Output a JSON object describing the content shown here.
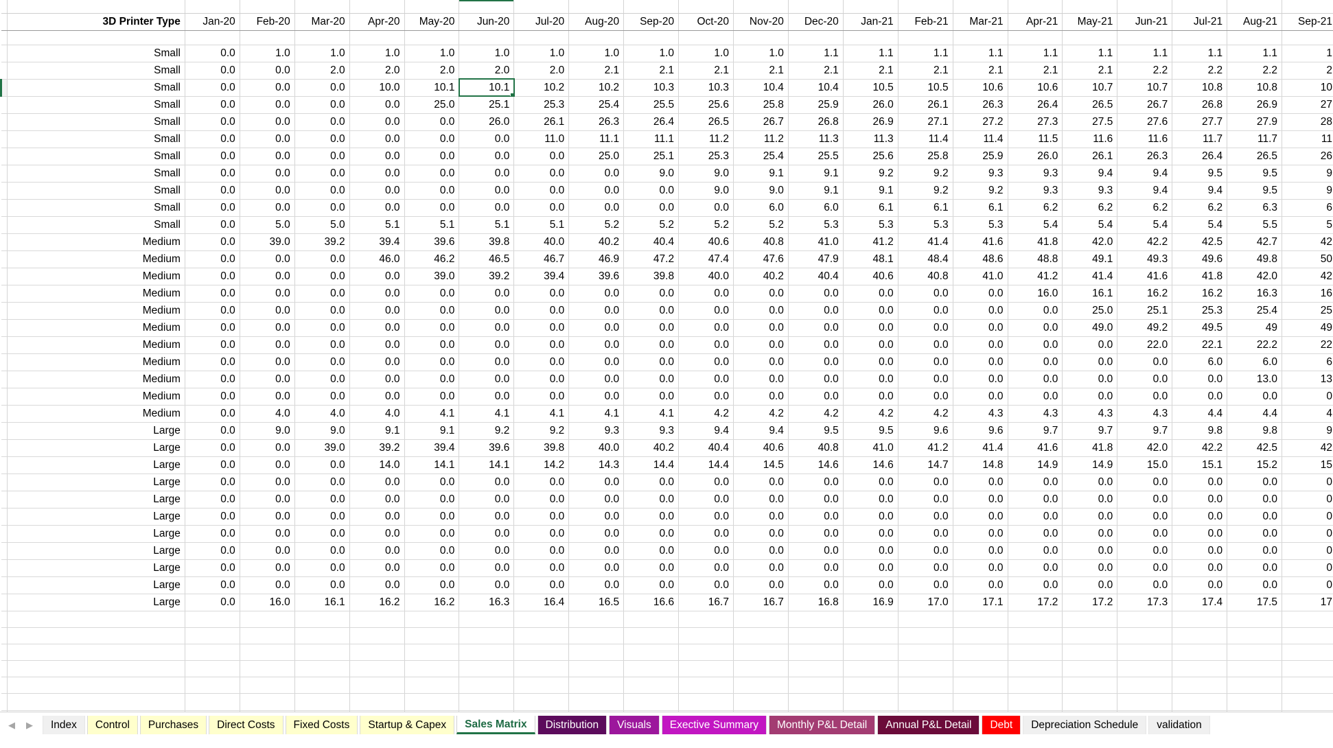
{
  "sheet": {
    "corner_label": "3D Printer Type",
    "months": [
      "Jan-20",
      "Feb-20",
      "Mar-20",
      "Apr-20",
      "May-20",
      "Jun-20",
      "Jul-20",
      "Aug-20",
      "Sep-20",
      "Oct-20",
      "Nov-20",
      "Dec-20",
      "Jan-21",
      "Feb-21",
      "Mar-21",
      "Apr-21",
      "May-21",
      "Jun-21",
      "Jul-21",
      "Aug-21",
      "Sep-21"
    ],
    "selection": {
      "column": "Jun-20",
      "row_index": 2,
      "value": "10.1",
      "border_color": "#217346"
    },
    "rows": [
      {
        "label": "Small",
        "values": [
          "0.0",
          "1.0",
          "1.0",
          "1.0",
          "1.0",
          "1.0",
          "1.0",
          "1.0",
          "1.0",
          "1.0",
          "1.0",
          "1.1",
          "1.1",
          "1.1",
          "1.1",
          "1.1",
          "1.1",
          "1.1",
          "1.1",
          "1.1",
          "1"
        ]
      },
      {
        "label": "Small",
        "values": [
          "0.0",
          "0.0",
          "2.0",
          "2.0",
          "2.0",
          "2.0",
          "2.0",
          "2.1",
          "2.1",
          "2.1",
          "2.1",
          "2.1",
          "2.1",
          "2.1",
          "2.1",
          "2.1",
          "2.1",
          "2.2",
          "2.2",
          "2.2",
          "2"
        ]
      },
      {
        "label": "Small",
        "values": [
          "0.0",
          "0.0",
          "0.0",
          "10.0",
          "10.1",
          "10.1",
          "10.2",
          "10.2",
          "10.3",
          "10.3",
          "10.4",
          "10.4",
          "10.5",
          "10.5",
          "10.6",
          "10.6",
          "10.7",
          "10.7",
          "10.8",
          "10.8",
          "10"
        ]
      },
      {
        "label": "Small",
        "values": [
          "0.0",
          "0.0",
          "0.0",
          "0.0",
          "25.0",
          "25.1",
          "25.3",
          "25.4",
          "25.5",
          "25.6",
          "25.8",
          "25.9",
          "26.0",
          "26.1",
          "26.3",
          "26.4",
          "26.5",
          "26.7",
          "26.8",
          "26.9",
          "27"
        ]
      },
      {
        "label": "Small",
        "values": [
          "0.0",
          "0.0",
          "0.0",
          "0.0",
          "0.0",
          "26.0",
          "26.1",
          "26.3",
          "26.4",
          "26.5",
          "26.7",
          "26.8",
          "26.9",
          "27.1",
          "27.2",
          "27.3",
          "27.5",
          "27.6",
          "27.7",
          "27.9",
          "28"
        ]
      },
      {
        "label": "Small",
        "values": [
          "0.0",
          "0.0",
          "0.0",
          "0.0",
          "0.0",
          "0.0",
          "11.0",
          "11.1",
          "11.1",
          "11.2",
          "11.2",
          "11.3",
          "11.3",
          "11.4",
          "11.4",
          "11.5",
          "11.6",
          "11.6",
          "11.7",
          "11.7",
          "11"
        ]
      },
      {
        "label": "Small",
        "values": [
          "0.0",
          "0.0",
          "0.0",
          "0.0",
          "0.0",
          "0.0",
          "0.0",
          "25.0",
          "25.1",
          "25.3",
          "25.4",
          "25.5",
          "25.6",
          "25.8",
          "25.9",
          "26.0",
          "26.1",
          "26.3",
          "26.4",
          "26.5",
          "26"
        ]
      },
      {
        "label": "Small",
        "values": [
          "0.0",
          "0.0",
          "0.0",
          "0.0",
          "0.0",
          "0.0",
          "0.0",
          "0.0",
          "9.0",
          "9.0",
          "9.1",
          "9.1",
          "9.2",
          "9.2",
          "9.3",
          "9.3",
          "9.4",
          "9.4",
          "9.5",
          "9.5",
          "9"
        ]
      },
      {
        "label": "Small",
        "values": [
          "0.0",
          "0.0",
          "0.0",
          "0.0",
          "0.0",
          "0.0",
          "0.0",
          "0.0",
          "0.0",
          "9.0",
          "9.0",
          "9.1",
          "9.1",
          "9.2",
          "9.2",
          "9.3",
          "9.3",
          "9.4",
          "9.4",
          "9.5",
          "9"
        ]
      },
      {
        "label": "Small",
        "values": [
          "0.0",
          "0.0",
          "0.0",
          "0.0",
          "0.0",
          "0.0",
          "0.0",
          "0.0",
          "0.0",
          "0.0",
          "6.0",
          "6.0",
          "6.1",
          "6.1",
          "6.1",
          "6.2",
          "6.2",
          "6.2",
          "6.2",
          "6.3",
          "6"
        ]
      },
      {
        "label": "Small",
        "values": [
          "0.0",
          "5.0",
          "5.0",
          "5.1",
          "5.1",
          "5.1",
          "5.1",
          "5.2",
          "5.2",
          "5.2",
          "5.2",
          "5.3",
          "5.3",
          "5.3",
          "5.3",
          "5.4",
          "5.4",
          "5.4",
          "5.4",
          "5.5",
          "5"
        ]
      },
      {
        "label": "Medium",
        "values": [
          "0.0",
          "39.0",
          "39.2",
          "39.4",
          "39.6",
          "39.8",
          "40.0",
          "40.2",
          "40.4",
          "40.6",
          "40.8",
          "41.0",
          "41.2",
          "41.4",
          "41.6",
          "41.8",
          "42.0",
          "42.2",
          "42.5",
          "42.7",
          "42"
        ]
      },
      {
        "label": "Medium",
        "values": [
          "0.0",
          "0.0",
          "0.0",
          "46.0",
          "46.2",
          "46.5",
          "46.7",
          "46.9",
          "47.2",
          "47.4",
          "47.6",
          "47.9",
          "48.1",
          "48.4",
          "48.6",
          "48.8",
          "49.1",
          "49.3",
          "49.6",
          "49.8",
          "50"
        ]
      },
      {
        "label": "Medium",
        "values": [
          "0.0",
          "0.0",
          "0.0",
          "0.0",
          "39.0",
          "39.2",
          "39.4",
          "39.6",
          "39.8",
          "40.0",
          "40.2",
          "40.4",
          "40.6",
          "40.8",
          "41.0",
          "41.2",
          "41.4",
          "41.6",
          "41.8",
          "42.0",
          "42"
        ]
      },
      {
        "label": "Medium",
        "values": [
          "0.0",
          "0.0",
          "0.0",
          "0.0",
          "0.0",
          "0.0",
          "0.0",
          "0.0",
          "0.0",
          "0.0",
          "0.0",
          "0.0",
          "0.0",
          "0.0",
          "0.0",
          "16.0",
          "16.1",
          "16.2",
          "16.2",
          "16.3",
          "16"
        ]
      },
      {
        "label": "Medium",
        "values": [
          "0.0",
          "0.0",
          "0.0",
          "0.0",
          "0.0",
          "0.0",
          "0.0",
          "0.0",
          "0.0",
          "0.0",
          "0.0",
          "0.0",
          "0.0",
          "0.0",
          "0.0",
          "0.0",
          "25.0",
          "25.1",
          "25.3",
          "25.4",
          "25"
        ]
      },
      {
        "label": "Medium",
        "values": [
          "0.0",
          "0.0",
          "0.0",
          "0.0",
          "0.0",
          "0.0",
          "0.0",
          "0.0",
          "0.0",
          "0.0",
          "0.0",
          "0.0",
          "0.0",
          "0.0",
          "0.0",
          "0.0",
          "49.0",
          "49.2",
          "49.5",
          "49",
          "49"
        ]
      },
      {
        "label": "Medium",
        "values": [
          "0.0",
          "0.0",
          "0.0",
          "0.0",
          "0.0",
          "0.0",
          "0.0",
          "0.0",
          "0.0",
          "0.0",
          "0.0",
          "0.0",
          "0.0",
          "0.0",
          "0.0",
          "0.0",
          "0.0",
          "22.0",
          "22.1",
          "22.2",
          "22"
        ]
      },
      {
        "label": "Medium",
        "values": [
          "0.0",
          "0.0",
          "0.0",
          "0.0",
          "0.0",
          "0.0",
          "0.0",
          "0.0",
          "0.0",
          "0.0",
          "0.0",
          "0.0",
          "0.0",
          "0.0",
          "0.0",
          "0.0",
          "0.0",
          "0.0",
          "6.0",
          "6.0",
          "6"
        ]
      },
      {
        "label": "Medium",
        "values": [
          "0.0",
          "0.0",
          "0.0",
          "0.0",
          "0.0",
          "0.0",
          "0.0",
          "0.0",
          "0.0",
          "0.0",
          "0.0",
          "0.0",
          "0.0",
          "0.0",
          "0.0",
          "0.0",
          "0.0",
          "0.0",
          "0.0",
          "13.0",
          "13"
        ]
      },
      {
        "label": "Medium",
        "values": [
          "0.0",
          "0.0",
          "0.0",
          "0.0",
          "0.0",
          "0.0",
          "0.0",
          "0.0",
          "0.0",
          "0.0",
          "0.0",
          "0.0",
          "0.0",
          "0.0",
          "0.0",
          "0.0",
          "0.0",
          "0.0",
          "0.0",
          "0.0",
          "0"
        ]
      },
      {
        "label": "Medium",
        "values": [
          "0.0",
          "4.0",
          "4.0",
          "4.0",
          "4.1",
          "4.1",
          "4.1",
          "4.1",
          "4.1",
          "4.2",
          "4.2",
          "4.2",
          "4.2",
          "4.2",
          "4.3",
          "4.3",
          "4.3",
          "4.3",
          "4.4",
          "4.4",
          "4"
        ]
      },
      {
        "label": "Large",
        "values": [
          "0.0",
          "9.0",
          "9.0",
          "9.1",
          "9.1",
          "9.2",
          "9.2",
          "9.3",
          "9.3",
          "9.4",
          "9.4",
          "9.5",
          "9.5",
          "9.6",
          "9.6",
          "9.7",
          "9.7",
          "9.7",
          "9.8",
          "9.8",
          "9"
        ]
      },
      {
        "label": "Large",
        "values": [
          "0.0",
          "0.0",
          "39.0",
          "39.2",
          "39.4",
          "39.6",
          "39.8",
          "40.0",
          "40.2",
          "40.4",
          "40.6",
          "40.8",
          "41.0",
          "41.2",
          "41.4",
          "41.6",
          "41.8",
          "42.0",
          "42.2",
          "42.5",
          "42"
        ]
      },
      {
        "label": "Large",
        "values": [
          "0.0",
          "0.0",
          "0.0",
          "14.0",
          "14.1",
          "14.1",
          "14.2",
          "14.3",
          "14.4",
          "14.4",
          "14.5",
          "14.6",
          "14.6",
          "14.7",
          "14.8",
          "14.9",
          "14.9",
          "15.0",
          "15.1",
          "15.2",
          "15"
        ]
      },
      {
        "label": "Large",
        "values": [
          "0.0",
          "0.0",
          "0.0",
          "0.0",
          "0.0",
          "0.0",
          "0.0",
          "0.0",
          "0.0",
          "0.0",
          "0.0",
          "0.0",
          "0.0",
          "0.0",
          "0.0",
          "0.0",
          "0.0",
          "0.0",
          "0.0",
          "0.0",
          "0"
        ]
      },
      {
        "label": "Large",
        "values": [
          "0.0",
          "0.0",
          "0.0",
          "0.0",
          "0.0",
          "0.0",
          "0.0",
          "0.0",
          "0.0",
          "0.0",
          "0.0",
          "0.0",
          "0.0",
          "0.0",
          "0.0",
          "0.0",
          "0.0",
          "0.0",
          "0.0",
          "0.0",
          "0"
        ]
      },
      {
        "label": "Large",
        "values": [
          "0.0",
          "0.0",
          "0.0",
          "0.0",
          "0.0",
          "0.0",
          "0.0",
          "0.0",
          "0.0",
          "0.0",
          "0.0",
          "0.0",
          "0.0",
          "0.0",
          "0.0",
          "0.0",
          "0.0",
          "0.0",
          "0.0",
          "0.0",
          "0"
        ]
      },
      {
        "label": "Large",
        "values": [
          "0.0",
          "0.0",
          "0.0",
          "0.0",
          "0.0",
          "0.0",
          "0.0",
          "0.0",
          "0.0",
          "0.0",
          "0.0",
          "0.0",
          "0.0",
          "0.0",
          "0.0",
          "0.0",
          "0.0",
          "0.0",
          "0.0",
          "0.0",
          "0"
        ]
      },
      {
        "label": "Large",
        "values": [
          "0.0",
          "0.0",
          "0.0",
          "0.0",
          "0.0",
          "0.0",
          "0.0",
          "0.0",
          "0.0",
          "0.0",
          "0.0",
          "0.0",
          "0.0",
          "0.0",
          "0.0",
          "0.0",
          "0.0",
          "0.0",
          "0.0",
          "0.0",
          "0"
        ]
      },
      {
        "label": "Large",
        "values": [
          "0.0",
          "0.0",
          "0.0",
          "0.0",
          "0.0",
          "0.0",
          "0.0",
          "0.0",
          "0.0",
          "0.0",
          "0.0",
          "0.0",
          "0.0",
          "0.0",
          "0.0",
          "0.0",
          "0.0",
          "0.0",
          "0.0",
          "0.0",
          "0"
        ]
      },
      {
        "label": "Large",
        "values": [
          "0.0",
          "0.0",
          "0.0",
          "0.0",
          "0.0",
          "0.0",
          "0.0",
          "0.0",
          "0.0",
          "0.0",
          "0.0",
          "0.0",
          "0.0",
          "0.0",
          "0.0",
          "0.0",
          "0.0",
          "0.0",
          "0.0",
          "0.0",
          "0"
        ]
      },
      {
        "label": "Large",
        "values": [
          "0.0",
          "16.0",
          "16.1",
          "16.2",
          "16.2",
          "16.3",
          "16.4",
          "16.5",
          "16.6",
          "16.7",
          "16.7",
          "16.8",
          "16.9",
          "17.0",
          "17.1",
          "17.2",
          "17.2",
          "17.3",
          "17.4",
          "17.5",
          "17"
        ]
      }
    ],
    "trailing_blank_rows": 7
  },
  "tabbar": {
    "prev_arrow": "◀",
    "next_arrow": "▶",
    "tabs": [
      {
        "label": "Index",
        "bg": "#f0f0f0",
        "fg": "#000000",
        "active": false
      },
      {
        "label": "Control",
        "bg": "#ffffcc",
        "fg": "#000000",
        "active": false
      },
      {
        "label": "Purchases",
        "bg": "#ffffcc",
        "fg": "#000000",
        "active": false
      },
      {
        "label": "Direct Costs",
        "bg": "#ffffcc",
        "fg": "#000000",
        "active": false
      },
      {
        "label": "Fixed Costs",
        "bg": "#ffffcc",
        "fg": "#000000",
        "active": false
      },
      {
        "label": "Startup & Capex",
        "bg": "#ffffcc",
        "fg": "#000000",
        "active": false
      },
      {
        "label": "Sales Matrix",
        "bg": "#ffffff",
        "fg": "#1e6b44",
        "active": true
      },
      {
        "label": "Distribution",
        "bg": "#5c0b5c",
        "fg": "#ffffff",
        "active": false
      },
      {
        "label": "Visuals",
        "bg": "#9c179c",
        "fg": "#ffffff",
        "active": false
      },
      {
        "label": "Exective Summary",
        "bg": "#c породa",
        "fg": "#ffffff",
        "active": false
      },
      {
        "label": "Monthly P&L Detail",
        "bg": "#a33c72",
        "fg": "#ffffff",
        "active": false
      },
      {
        "label": "Annual P&L Detail",
        "bg": "#6b0b3a",
        "fg": "#ffffff",
        "active": false
      },
      {
        "label": "Debt",
        "bg": "#ff0000",
        "fg": "#ffffff",
        "active": false
      },
      {
        "label": "Depreciation Schedule",
        "bg": "#f0f0f0",
        "fg": "#000000",
        "active": false
      },
      {
        "label": "validation",
        "bg": "#f0f0f0",
        "fg": "#000000",
        "active": false
      }
    ]
  }
}
